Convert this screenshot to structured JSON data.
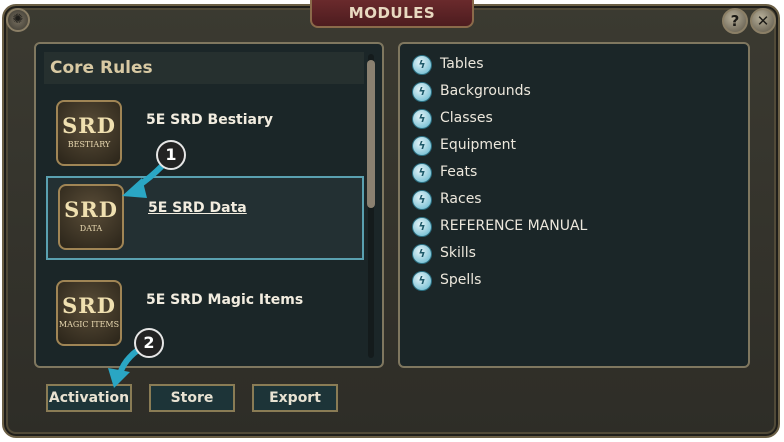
{
  "window": {
    "title": "MODULES"
  },
  "header": {
    "help_label": "?",
    "close_label": "✕",
    "corner_icon": "dragon-emblem-icon"
  },
  "left_panel": {
    "header": "Core Rules",
    "modules": [
      {
        "name": "5E SRD Bestiary",
        "thumb_main": "SRD",
        "thumb_sub": "BESTIARY",
        "selected": false
      },
      {
        "name": "5E SRD Data",
        "thumb_main": "SRD",
        "thumb_sub": "DATA",
        "selected": true
      },
      {
        "name": "5E SRD Magic Items",
        "thumb_main": "SRD",
        "thumb_sub": "MAGIC ITEMS",
        "selected": false
      }
    ]
  },
  "right_panel": {
    "categories": [
      "Tables",
      "Backgrounds",
      "Classes",
      "Equipment",
      "Feats",
      "Races",
      "REFERENCE MANUAL",
      "Skills",
      "Spells"
    ],
    "category_icon": "dragon-badge-icon"
  },
  "footer": {
    "activation_label": "Activation",
    "store_label": "Store",
    "export_label": "Export"
  },
  "callouts": {
    "one": "1",
    "two": "2"
  },
  "colors": {
    "accent": "#2aa6c4",
    "selection_border": "#5aa0b0",
    "title_tab": "#5a2226"
  }
}
